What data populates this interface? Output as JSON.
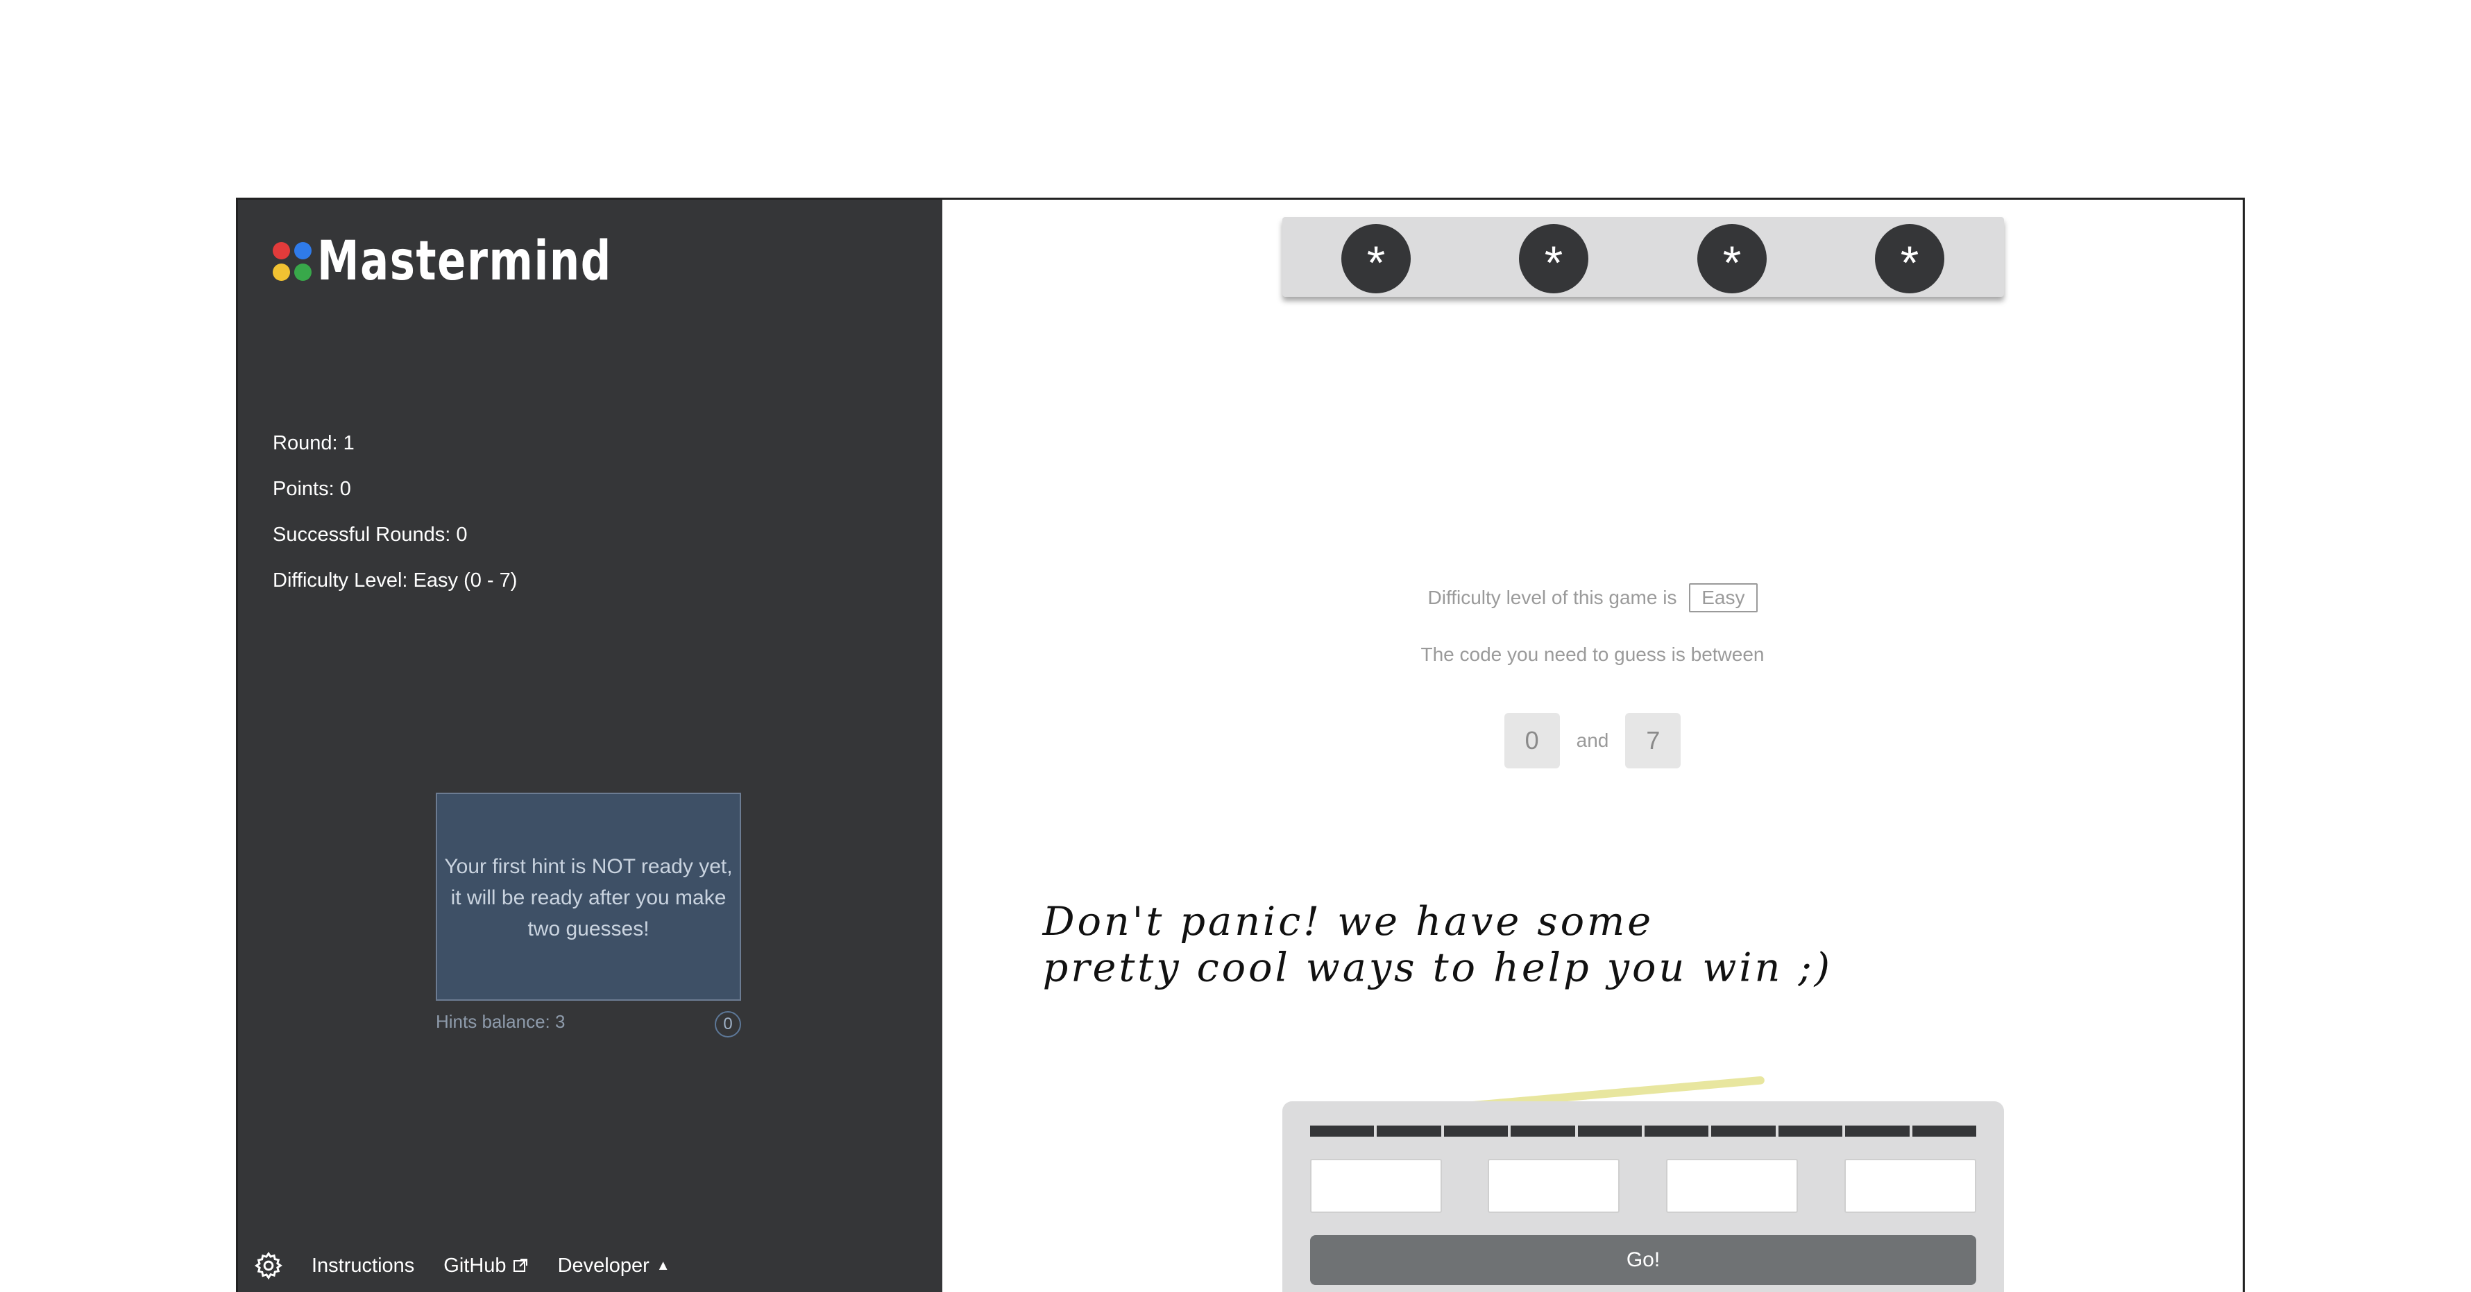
{
  "brand": {
    "title": "Mastermind",
    "dot_colors": [
      "#e23b3b",
      "#2f7bea",
      "#f1c232",
      "#38a84a"
    ]
  },
  "stats": {
    "round": "Round: 1",
    "points": "Points: 0",
    "successful_rounds": "Successful Rounds: 0",
    "difficulty": "Difficulty Level: Easy (0 - 7)"
  },
  "hint": {
    "message": "Your first hint is NOT ready yet, it will be ready after you make two guesses!",
    "balance_label": "Hints balance: 3",
    "count": "0"
  },
  "footer": {
    "instructions": "Instructions",
    "github": "GitHub",
    "developer": "Developer"
  },
  "secret_code": [
    "*",
    "*",
    "*",
    "*"
  ],
  "game_info": {
    "difficulty_prefix": "Difficulty level of this game is",
    "difficulty_value": "Easy",
    "range_text": "The code you need to guess is between",
    "range_min": "0",
    "range_and": "and",
    "range_max": "7"
  },
  "handwritten_note": {
    "line1": "Don't panic! we have some",
    "line2": "pretty cool ways to help you win ;)",
    "highlight_color": "#e4e28e"
  },
  "guess_panel": {
    "go_label": "Go!"
  }
}
